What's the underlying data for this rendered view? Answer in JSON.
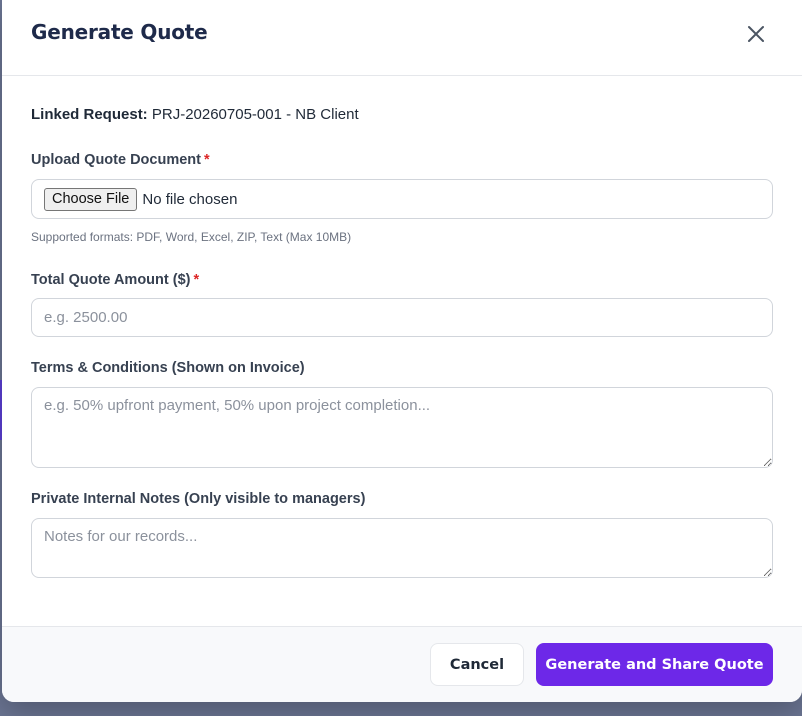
{
  "modal": {
    "title": "Generate Quote",
    "close_icon": "close-icon"
  },
  "linked_request": {
    "label": "Linked Request:",
    "value": "PRJ-20260705-001 - NB Client"
  },
  "upload": {
    "label": "Upload Quote Document",
    "required_mark": "*",
    "choose_button": "Choose File",
    "status": "No file chosen",
    "hint": "Supported formats: PDF, Word, Excel, ZIP, Text (Max 10MB)"
  },
  "amount": {
    "label": "Total Quote Amount ($)",
    "required_mark": "*",
    "value": "",
    "placeholder": "e.g. 2500.00"
  },
  "terms": {
    "label": "Terms & Conditions (Shown on Invoice)",
    "value": "",
    "placeholder": "e.g. 50% upfront payment, 50% upon project completion..."
  },
  "notes": {
    "label": "Private Internal Notes (Only visible to managers)",
    "value": "",
    "placeholder": "Notes for our records..."
  },
  "footer": {
    "cancel_label": "Cancel",
    "submit_label": "Generate and Share Quote"
  },
  "colors": {
    "primary": "#6d28e8",
    "required": "#dc2626",
    "title": "#1e2a4a",
    "backdrop": "#6b7593"
  }
}
